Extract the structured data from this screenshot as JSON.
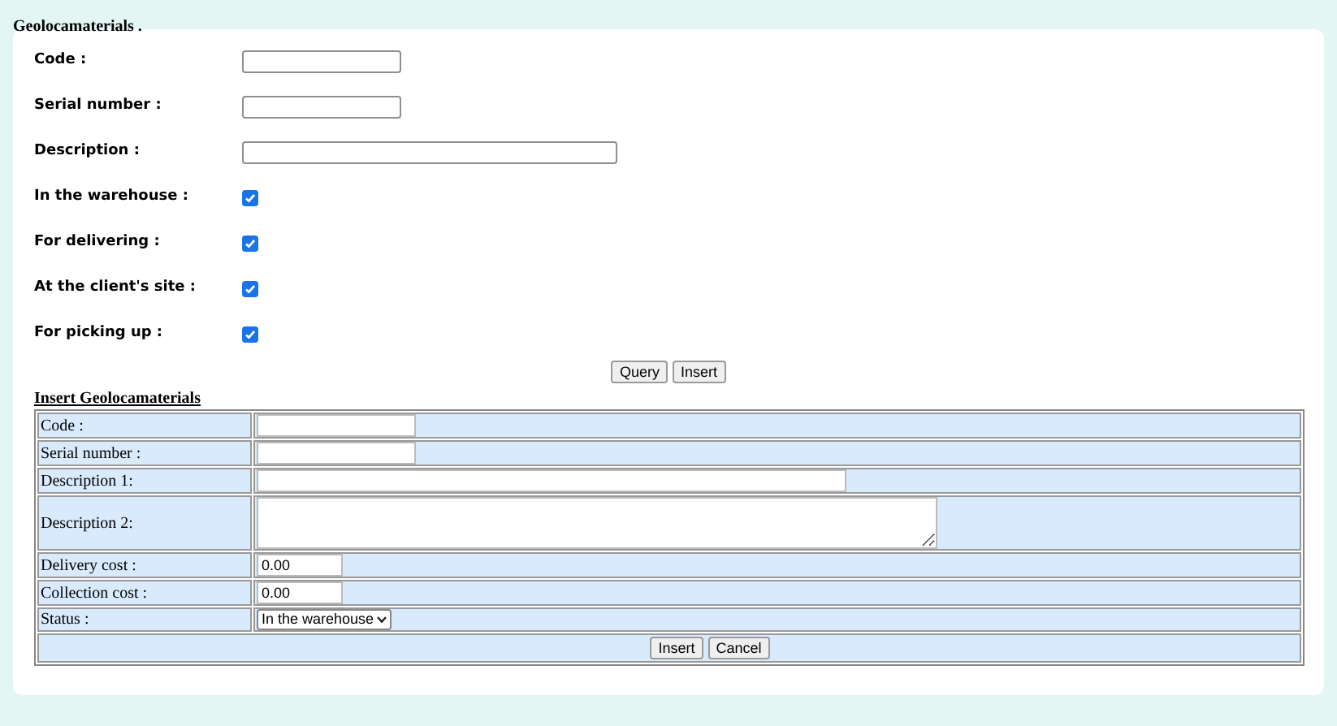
{
  "title": "Geolocamaterials .",
  "query_form": {
    "fields": [
      {
        "label": "Code :",
        "kind": "text"
      },
      {
        "label": "Serial number :",
        "kind": "text"
      },
      {
        "label": "Description :",
        "kind": "wide-text"
      },
      {
        "label": "In the warehouse :",
        "kind": "checkbox",
        "checked": true
      },
      {
        "label": "For delivering :",
        "kind": "checkbox",
        "checked": true
      },
      {
        "label": "At the client's site :",
        "kind": "checkbox",
        "checked": true
      },
      {
        "label": "For picking up :",
        "kind": "checkbox",
        "checked": true
      }
    ],
    "buttons": [
      "Query",
      "Insert"
    ]
  },
  "insert_form": {
    "heading": "Insert Geolocamaterials",
    "rows": [
      {
        "label": "Code :",
        "kind": "text"
      },
      {
        "label": "Serial number :",
        "kind": "text"
      },
      {
        "label": "Description 1:",
        "kind": "wide-text"
      },
      {
        "label": "Description 2:",
        "kind": "textarea"
      },
      {
        "label": "Delivery cost :",
        "kind": "number",
        "value": "0.00"
      },
      {
        "label": "Collection cost :",
        "kind": "number",
        "value": "0.00"
      },
      {
        "label": "Status :",
        "kind": "select",
        "value": "In the warehouse"
      }
    ],
    "buttons": [
      "Insert",
      "Cancel"
    ]
  }
}
